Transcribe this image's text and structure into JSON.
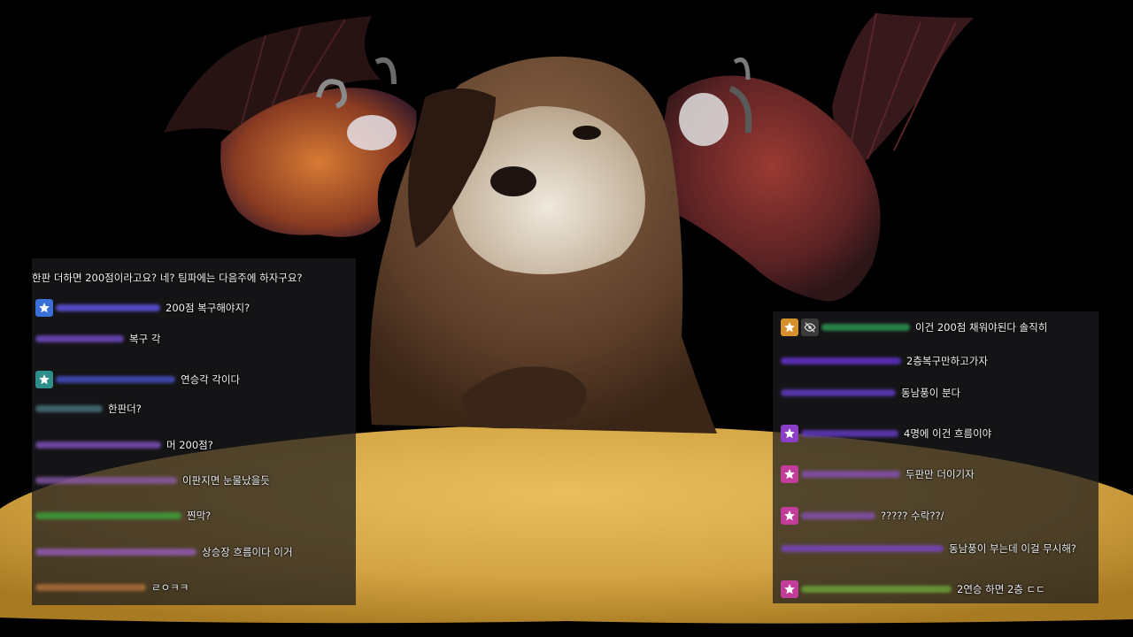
{
  "left_chat": {
    "headline": "한판 더하면 200점이라고요? 네? 팀파에는 다음주에 하자구요?",
    "messages": [
      {
        "badge": "star-blue",
        "nick_color": "#6a5cff",
        "text": "200점 복구해야지?"
      },
      {
        "badge": "",
        "nick_color": "#7b4fd8",
        "text": "복구 각"
      },
      {
        "badge": "star-teal",
        "nick_color": "#4a56d6",
        "text": "연승각 각이다"
      },
      {
        "badge": "",
        "nick_color": "#4d7a86",
        "text": "한판더?"
      },
      {
        "badge": "",
        "nick_color": "#8a56c7",
        "text": "머 200점?"
      },
      {
        "badge": "",
        "nick_color": "#8e5bb0",
        "text": "이판지면 눈물났을듯"
      },
      {
        "badge": "",
        "nick_color": "#3ba83b",
        "text": "찐막?"
      },
      {
        "badge": "",
        "nick_color": "#9a5cc6",
        "text": "상승장 흐름이다 이거"
      },
      {
        "badge": "",
        "nick_color": "#b8743a",
        "text": "ㄹㅇㅋㅋ"
      }
    ]
  },
  "right_chat": {
    "messages": [
      {
        "badge": "star-gold",
        "badge2": "eye-slash",
        "nick_color": "#2fa85a",
        "text": "이건 200점 채워야된다 솔직히"
      },
      {
        "badge": "",
        "nick_color": "#6a34e0",
        "text": "2층복구만하고가자"
      },
      {
        "badge": "",
        "nick_color": "#6b3fd6",
        "text": "동남풍이 분다"
      },
      {
        "badge": "star-purple",
        "nick_color": "#6b3fd6",
        "text": "4명에 이건 흐름이야"
      },
      {
        "badge": "star-pink",
        "nick_color": "#8a4fc0",
        "text": "두판만 더이기자"
      },
      {
        "badge": "star-pink",
        "nick_color": "#8a4fc0",
        "text": "????? 수락??/"
      },
      {
        "badge": "",
        "nick_color": "#7b45d0",
        "text": "동남풍이 부는데 이걸 무시해?"
      },
      {
        "badge": "star-pink",
        "nick_color": "#6fae3a",
        "text": "2연승 하면 2층 ㄷㄷ"
      }
    ]
  },
  "colors": {
    "background": "#000000",
    "table_surface": "#d2a542",
    "otter_fur": "#6e4b32",
    "dragon_left": "#b85a2e",
    "dragon_right": "#7a2a28"
  }
}
